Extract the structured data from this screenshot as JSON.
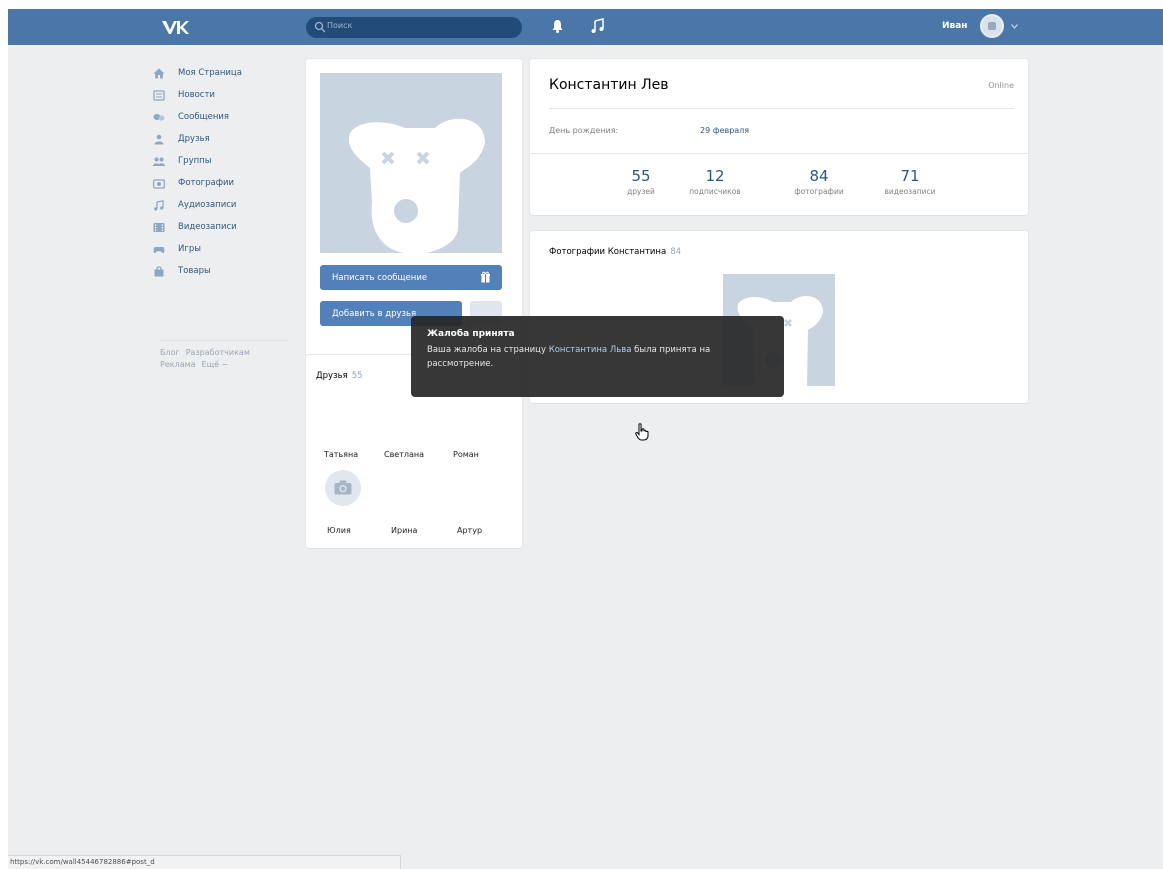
{
  "header": {
    "search_placeholder": "Поиск",
    "user_name": "Иван"
  },
  "menu": {
    "items": [
      {
        "label": "Моя Страница",
        "icon": "home-icon"
      },
      {
        "label": "Новости",
        "icon": "news-icon"
      },
      {
        "label": "Сообщения",
        "icon": "messages-icon"
      },
      {
        "label": "Друзья",
        "icon": "friends-icon"
      },
      {
        "label": "Группы",
        "icon": "groups-icon"
      },
      {
        "label": "Фотографии",
        "icon": "photos-icon"
      },
      {
        "label": "Аудиозаписи",
        "icon": "music-icon"
      },
      {
        "label": "Видеозаписи",
        "icon": "video-icon"
      },
      {
        "label": "Игры",
        "icon": "games-icon"
      },
      {
        "label": "Товары",
        "icon": "market-icon"
      }
    ],
    "footer": [
      "Блог",
      "Разработчикам",
      "Реклама",
      "Ещё ~"
    ]
  },
  "profile": {
    "name": "Константин Лев",
    "status": "Online",
    "birthday_label": "День рождения:",
    "birthday_value": "29 февраля",
    "message_button": "Написать сообщение",
    "add_friend_button": "Добавить в друзья",
    "stats": [
      {
        "value": "55",
        "label": "друзей"
      },
      {
        "value": "12",
        "label": "подписчиков"
      },
      {
        "value": "84",
        "label": "фотографии"
      },
      {
        "value": "71",
        "label": "видеозаписи"
      }
    ]
  },
  "friends": {
    "title": "Друзья",
    "count": "55",
    "row1": [
      "Татьяна",
      "Светлана",
      "Роман"
    ],
    "row2": [
      "Юлия",
      "Ирина",
      "Артур"
    ]
  },
  "photos": {
    "title": "Фотографии Константина",
    "count": "84"
  },
  "toast": {
    "title": "Жалоба принята",
    "body_before": "Ваша жалоба на страницу ",
    "body_link": "Константина Льва",
    "body_after": " была принята на рассмотрение."
  },
  "statusbar": {
    "url": "https://vk.com/wall45446782886#post_d"
  },
  "colors": {
    "header_bg": "#4a76a8",
    "accent": "#5181b8",
    "link": "#2a5885",
    "page_bg": "#edeef0"
  }
}
